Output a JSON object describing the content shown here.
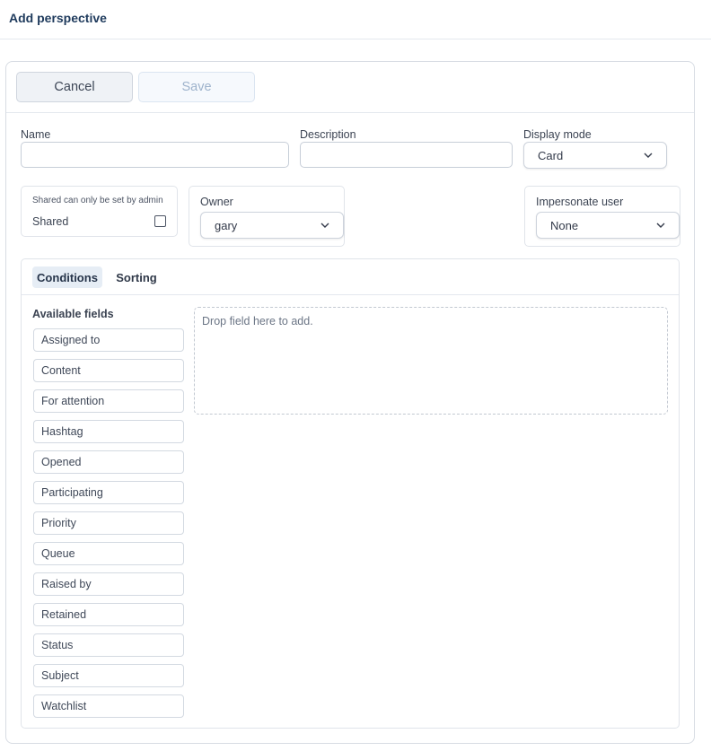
{
  "page": {
    "title": "Add perspective"
  },
  "toolbar": {
    "cancel_label": "Cancel",
    "save_label": "Save"
  },
  "form": {
    "name": {
      "label": "Name",
      "value": ""
    },
    "description": {
      "label": "Description",
      "value": ""
    },
    "display_mode": {
      "label": "Display mode",
      "value": "Card"
    },
    "shared": {
      "note": "Shared can only be set by admin",
      "label": "Shared",
      "checked": false
    },
    "owner": {
      "label": "Owner",
      "value": "gary"
    },
    "impersonate": {
      "label": "Impersonate user",
      "value": "None"
    }
  },
  "tabs": [
    {
      "label": "Conditions",
      "active": true
    },
    {
      "label": "Sorting",
      "active": false
    }
  ],
  "available_fields": {
    "title": "Available fields",
    "items": [
      "Assigned to",
      "Content",
      "For attention",
      "Hashtag",
      "Opened",
      "Participating",
      "Priority",
      "Queue",
      "Raised by",
      "Retained",
      "Status",
      "Subject",
      "Watchlist"
    ]
  },
  "dropzone": {
    "text": "Drop field here to add."
  },
  "icons": {
    "select_chevron": "chevron-down-icon"
  }
}
